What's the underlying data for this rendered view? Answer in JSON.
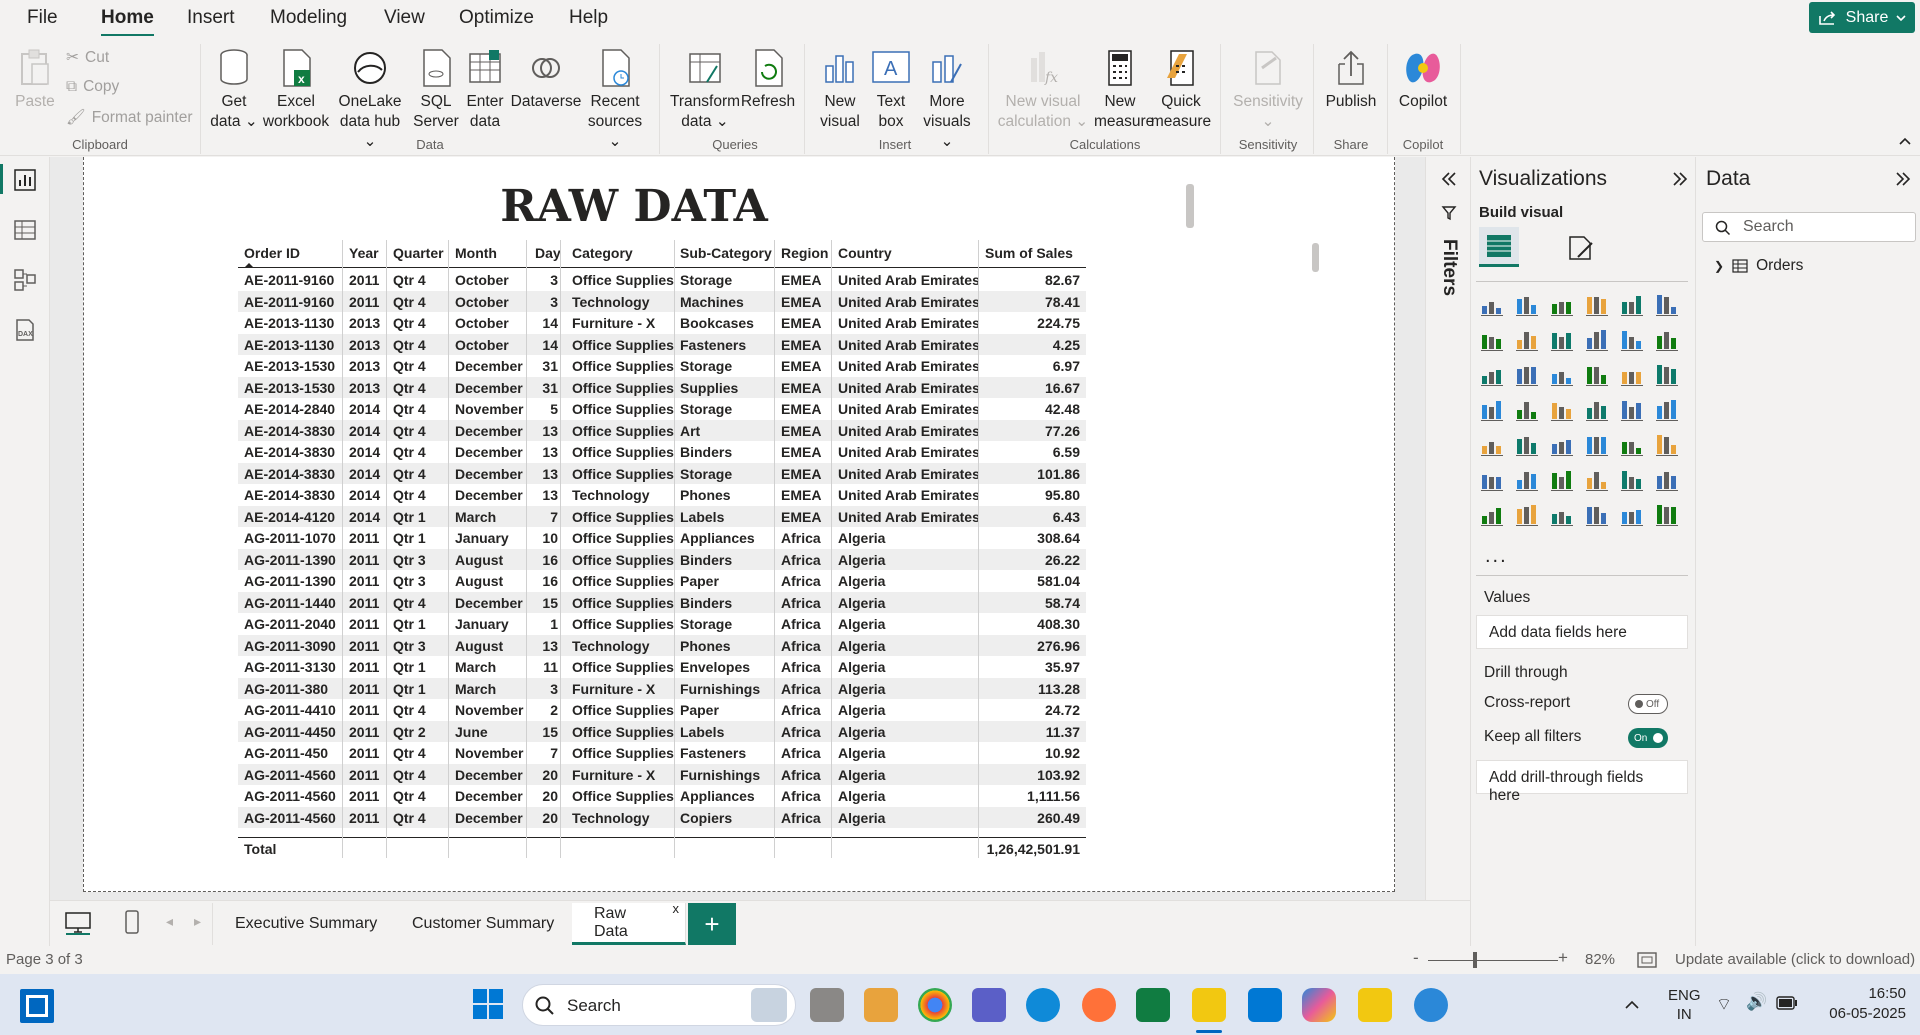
{
  "menu": {
    "items": [
      "File",
      "Home",
      "Insert",
      "Modeling",
      "View",
      "Optimize",
      "Help"
    ],
    "active": "Home",
    "share_label": "Share"
  },
  "ribbon": {
    "clipboard": {
      "paste": "Paste",
      "cut": "Cut",
      "copy": "Copy",
      "format_painter": "Format painter",
      "label": "Clipboard"
    },
    "data": {
      "get_data": [
        "Get",
        "data"
      ],
      "excel": [
        "Excel",
        "workbook"
      ],
      "onelake": [
        "OneLake",
        "data hub"
      ],
      "sql": [
        "SQL",
        "Server"
      ],
      "enter": [
        "Enter",
        "data"
      ],
      "dataverse": [
        "Dataverse"
      ],
      "recent": [
        "Recent",
        "sources"
      ],
      "label": "Data"
    },
    "queries": {
      "transform": [
        "Transform",
        "data"
      ],
      "refresh": [
        "Refresh"
      ],
      "label": "Queries"
    },
    "insert": {
      "new_visual": [
        "New",
        "visual"
      ],
      "text_box": [
        "Text",
        "box"
      ],
      "more_visuals": [
        "More",
        "visuals"
      ],
      "label": "Insert"
    },
    "calculations": {
      "new_visual_calc": [
        "New visual",
        "calculation"
      ],
      "new_measure": [
        "New",
        "measure"
      ],
      "quick_measure": [
        "Quick",
        "measure"
      ],
      "label": "Calculations"
    },
    "sensitivity": {
      "btn": [
        "Sensitivity"
      ],
      "label": "Sensitivity"
    },
    "share": {
      "publish": [
        "Publish"
      ],
      "label": "Share"
    },
    "copilot": {
      "btn": [
        "Copilot"
      ],
      "label": "Copilot"
    }
  },
  "report": {
    "title": "RAW DATA",
    "columns": [
      "Order ID",
      "Year",
      "Quarter",
      "Month",
      "Day",
      "Category",
      "Sub-Category",
      "Region",
      "Country",
      "Sum of Sales"
    ],
    "rows": [
      [
        "AE-2011-9160",
        "2011",
        "Qtr 4",
        "October",
        "3",
        "Office Supplies",
        "Storage",
        "EMEA",
        "United Arab Emirates",
        "82.67"
      ],
      [
        "AE-2011-9160",
        "2011",
        "Qtr 4",
        "October",
        "3",
        "Technology",
        "Machines",
        "EMEA",
        "United Arab Emirates",
        "78.41"
      ],
      [
        "AE-2013-1130",
        "2013",
        "Qtr 4",
        "October",
        "14",
        "Furniture - X",
        "Bookcases",
        "EMEA",
        "United Arab Emirates",
        "224.75"
      ],
      [
        "AE-2013-1130",
        "2013",
        "Qtr 4",
        "October",
        "14",
        "Office Supplies",
        "Fasteners",
        "EMEA",
        "United Arab Emirates",
        "4.25"
      ],
      [
        "AE-2013-1530",
        "2013",
        "Qtr 4",
        "December",
        "31",
        "Office Supplies",
        "Storage",
        "EMEA",
        "United Arab Emirates",
        "6.97"
      ],
      [
        "AE-2013-1530",
        "2013",
        "Qtr 4",
        "December",
        "31",
        "Office Supplies",
        "Supplies",
        "EMEA",
        "United Arab Emirates",
        "16.67"
      ],
      [
        "AE-2014-2840",
        "2014",
        "Qtr 4",
        "November",
        "5",
        "Office Supplies",
        "Storage",
        "EMEA",
        "United Arab Emirates",
        "42.48"
      ],
      [
        "AE-2014-3830",
        "2014",
        "Qtr 4",
        "December",
        "13",
        "Office Supplies",
        "Art",
        "EMEA",
        "United Arab Emirates",
        "77.26"
      ],
      [
        "AE-2014-3830",
        "2014",
        "Qtr 4",
        "December",
        "13",
        "Office Supplies",
        "Binders",
        "EMEA",
        "United Arab Emirates",
        "6.59"
      ],
      [
        "AE-2014-3830",
        "2014",
        "Qtr 4",
        "December",
        "13",
        "Office Supplies",
        "Storage",
        "EMEA",
        "United Arab Emirates",
        "101.86"
      ],
      [
        "AE-2014-3830",
        "2014",
        "Qtr 4",
        "December",
        "13",
        "Technology",
        "Phones",
        "EMEA",
        "United Arab Emirates",
        "95.80"
      ],
      [
        "AE-2014-4120",
        "2014",
        "Qtr 1",
        "March",
        "7",
        "Office Supplies",
        "Labels",
        "EMEA",
        "United Arab Emirates",
        "6.43"
      ],
      [
        "AG-2011-1070",
        "2011",
        "Qtr 1",
        "January",
        "10",
        "Office Supplies",
        "Appliances",
        "Africa",
        "Algeria",
        "308.64"
      ],
      [
        "AG-2011-1390",
        "2011",
        "Qtr 3",
        "August",
        "16",
        "Office Supplies",
        "Binders",
        "Africa",
        "Algeria",
        "26.22"
      ],
      [
        "AG-2011-1390",
        "2011",
        "Qtr 3",
        "August",
        "16",
        "Office Supplies",
        "Paper",
        "Africa",
        "Algeria",
        "581.04"
      ],
      [
        "AG-2011-1440",
        "2011",
        "Qtr 4",
        "December",
        "15",
        "Office Supplies",
        "Binders",
        "Africa",
        "Algeria",
        "58.74"
      ],
      [
        "AG-2011-2040",
        "2011",
        "Qtr 1",
        "January",
        "1",
        "Office Supplies",
        "Storage",
        "Africa",
        "Algeria",
        "408.30"
      ],
      [
        "AG-2011-3090",
        "2011",
        "Qtr 3",
        "August",
        "13",
        "Technology",
        "Phones",
        "Africa",
        "Algeria",
        "276.96"
      ],
      [
        "AG-2011-3130",
        "2011",
        "Qtr 1",
        "March",
        "11",
        "Office Supplies",
        "Envelopes",
        "Africa",
        "Algeria",
        "35.97"
      ],
      [
        "AG-2011-380",
        "2011",
        "Qtr 1",
        "March",
        "3",
        "Furniture - X",
        "Furnishings",
        "Africa",
        "Algeria",
        "113.28"
      ],
      [
        "AG-2011-4410",
        "2011",
        "Qtr 4",
        "November",
        "2",
        "Office Supplies",
        "Paper",
        "Africa",
        "Algeria",
        "24.72"
      ],
      [
        "AG-2011-4450",
        "2011",
        "Qtr 2",
        "June",
        "15",
        "Office Supplies",
        "Labels",
        "Africa",
        "Algeria",
        "11.37"
      ],
      [
        "AG-2011-450",
        "2011",
        "Qtr 4",
        "November",
        "7",
        "Office Supplies",
        "Fasteners",
        "Africa",
        "Algeria",
        "10.92"
      ],
      [
        "AG-2011-4560",
        "2011",
        "Qtr 4",
        "December",
        "20",
        "Furniture - X",
        "Furnishings",
        "Africa",
        "Algeria",
        "103.92"
      ],
      [
        "AG-2011-4560",
        "2011",
        "Qtr 4",
        "December",
        "20",
        "Office Supplies",
        "Appliances",
        "Africa",
        "Algeria",
        "1,111.56"
      ],
      [
        "AG-2011-4560",
        "2011",
        "Qtr 4",
        "December",
        "20",
        "Technology",
        "Copiers",
        "Africa",
        "Algeria",
        "260.49"
      ]
    ],
    "total_label": "Total",
    "total_value": "1,26,42,501.91"
  },
  "tabs": {
    "pages": [
      "Executive Summary",
      "Customer Summary",
      "Raw Data"
    ],
    "active": "Raw Data",
    "add": "+",
    "close": "x"
  },
  "status": {
    "page": "Page 3 of 3",
    "zoom": "82%",
    "update": "Update available (click to download)",
    "zoom_minus": "-",
    "zoom_plus": "+"
  },
  "filters": {
    "label": "Filters"
  },
  "visualizations": {
    "title": "Visualizations",
    "build": "Build visual",
    "more": "...",
    "values_label": "Values",
    "values_well": "Add data fields here",
    "drill_label": "Drill through",
    "cross_report": "Cross-report",
    "cross_report_state": "Off",
    "keep_filters": "Keep all filters",
    "keep_filters_state": "On",
    "drill_well": "Add drill-through fields here",
    "icon_colors": [
      "#3b6fb6",
      "#2b88d8",
      "#107c10",
      "#e8a33d",
      "#0e7a6b"
    ]
  },
  "data_pane": {
    "title": "Data",
    "search_placeholder": "Search",
    "tables": [
      "Orders"
    ]
  },
  "taskbar": {
    "search": "Search",
    "lang1": "ENG",
    "lang2": "IN",
    "time": "16:50",
    "date": "06-05-2025"
  }
}
